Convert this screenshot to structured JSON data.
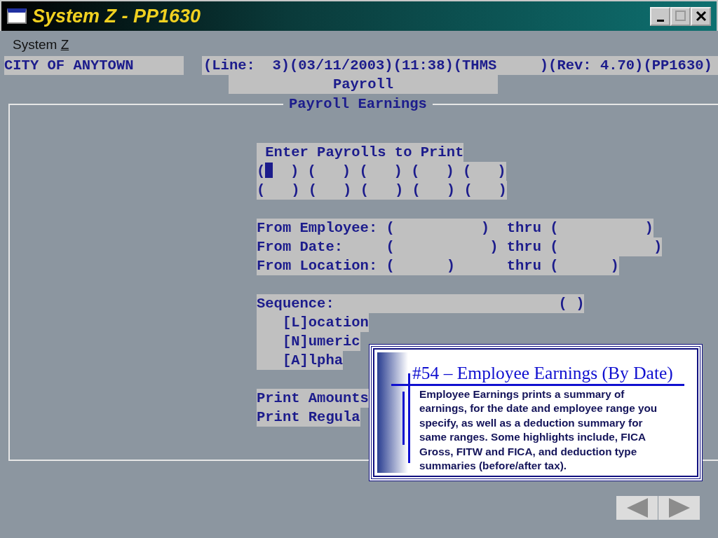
{
  "window": {
    "title": "System Z - PP1630"
  },
  "menu": [
    {
      "label_before": "System ",
      "mnemonic": "Z"
    }
  ],
  "header": {
    "organization": "CITY OF ANYTOWN",
    "status": "(Line:  3)(03/11/2003)(11:38)(THMS     )(Rev: 4.70)(PP1630)",
    "module": "Payroll"
  },
  "panel": {
    "title": "Payroll Earnings",
    "lines": [
      {
        "kind": "text",
        "text": " Enter Payrolls to Print"
      },
      {
        "kind": "fields",
        "fields": [
          {
            "open": "(",
            "close": ")",
            "cursor": true
          },
          {
            "open": "(",
            "close": ")",
            "cursor": false
          },
          {
            "open": "(",
            "close": ")",
            "cursor": false
          },
          {
            "open": "(",
            "close": ")",
            "cursor": false
          },
          {
            "open": "(",
            "close": ")",
            "cursor": false
          }
        ]
      },
      {
        "kind": "fields",
        "fields": [
          {
            "open": "(",
            "close": ")",
            "cursor": false
          },
          {
            "open": "(",
            "close": ")",
            "cursor": false
          },
          {
            "open": "(",
            "close": ")",
            "cursor": false
          },
          {
            "open": "(",
            "close": ")",
            "cursor": false
          },
          {
            "open": "(",
            "close": ")",
            "cursor": false
          }
        ]
      },
      {
        "kind": "blank"
      },
      {
        "kind": "text",
        "text": "From Employee: (          )  thru (          )"
      },
      {
        "kind": "text",
        "text": "From Date:     (           ) thru (           )"
      },
      {
        "kind": "text",
        "text": "From Location: (      )      thru (      )"
      },
      {
        "kind": "blank"
      },
      {
        "kind": "text",
        "text": "Sequence:                          ( )"
      },
      {
        "kind": "text",
        "text": "   [L]ocation"
      },
      {
        "kind": "text",
        "text": "   [N]umeric"
      },
      {
        "kind": "text",
        "text": "   [A]lpha"
      },
      {
        "kind": "blank"
      },
      {
        "kind": "text",
        "text": "Print Amounts"
      },
      {
        "kind": "text",
        "text": "Print Regula"
      }
    ]
  },
  "callout": {
    "title": "#54 – Employee Earnings (By Date)",
    "body": "Employee Earnings prints a summary of earnings, for the date and employee range you specify, as well as a deduction summary for same ranges.  Some highlights include, FICA Gross, FITW and FICA, and deduction type summaries (before/after tax)."
  },
  "slide_nav": [
    {
      "kind": "previous"
    },
    {
      "kind": "next"
    }
  ]
}
